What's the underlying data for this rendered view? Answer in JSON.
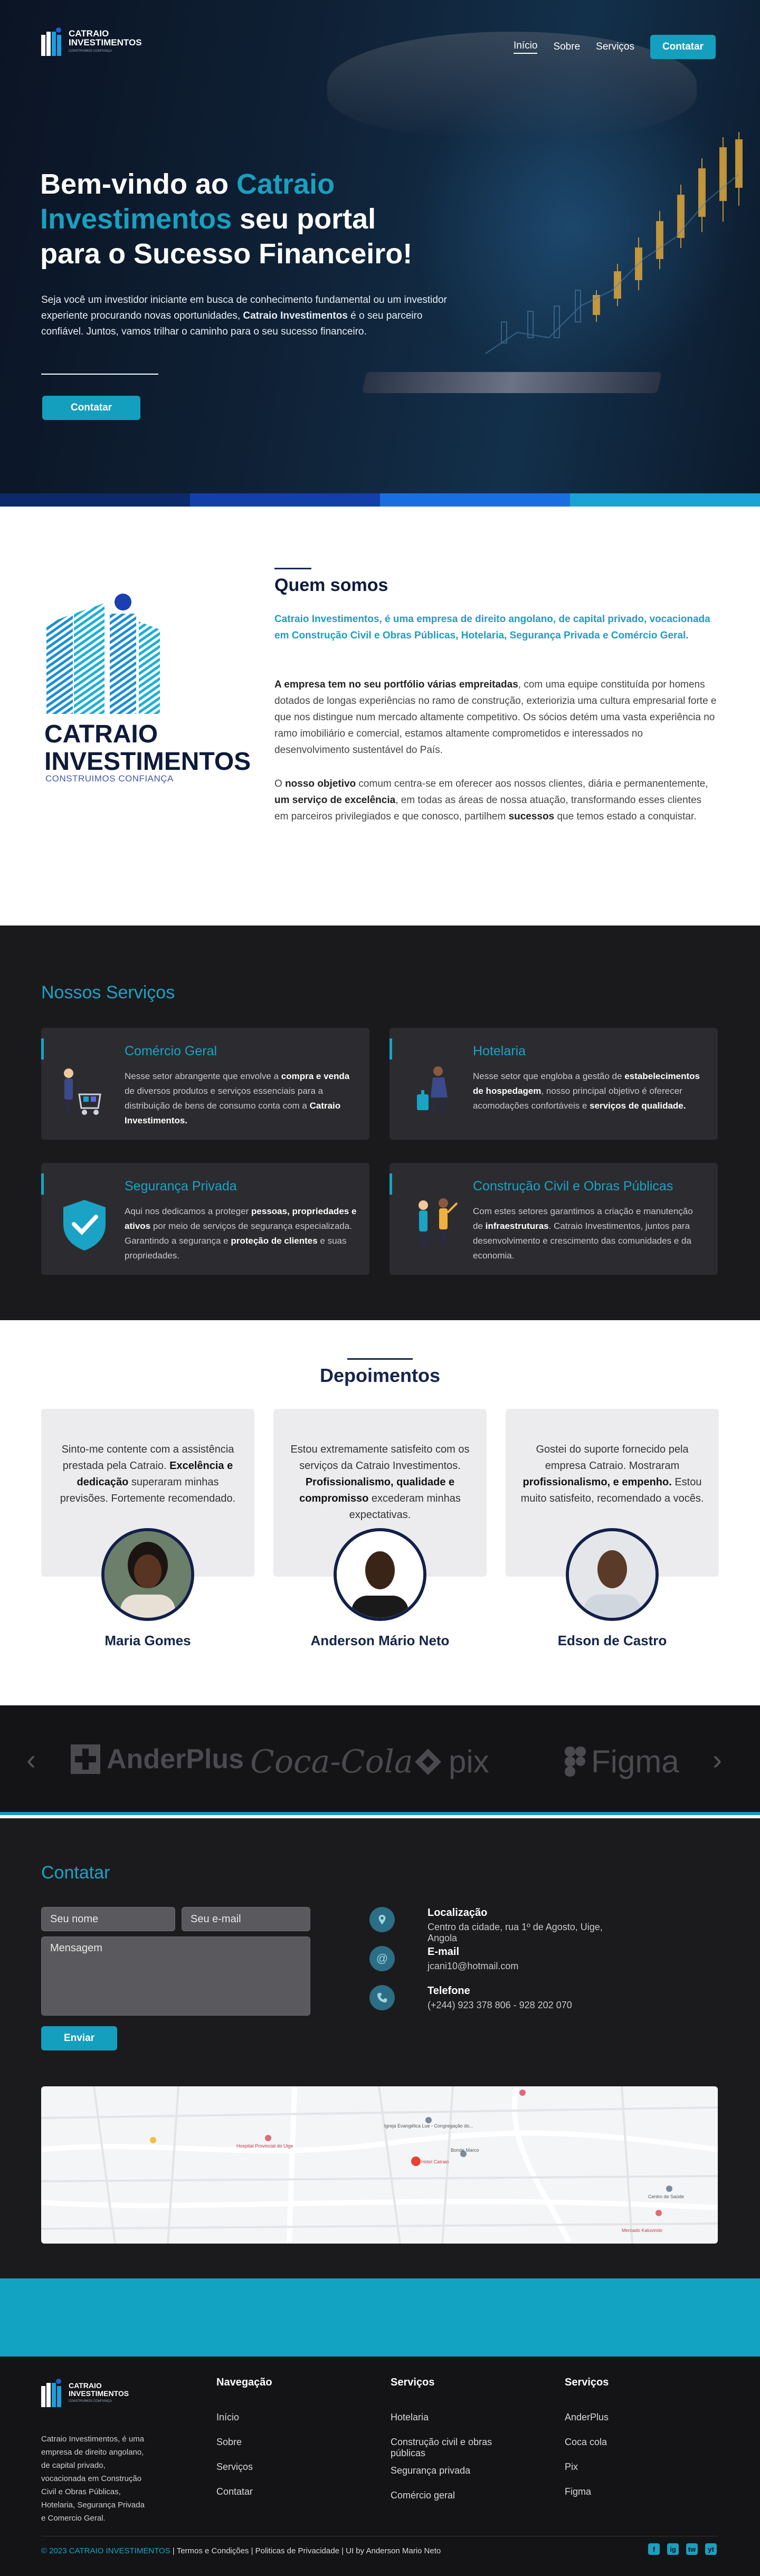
{
  "brand": {
    "name_line1": "CATRAIO",
    "name_line2": "INVESTIMENTOS",
    "tagline": "CONSTRUIMOS CONFIANÇA"
  },
  "nav": {
    "items": [
      "Início",
      "Sobre",
      "Serviços"
    ],
    "contact_label": "Contatar"
  },
  "hero": {
    "title_pre": "Bem-vindo ao ",
    "title_brand": "Catraio Investimentos",
    "title_post": " seu portal para o Sucesso Financeiro!",
    "text_pre": "Seja você um investidor iniciante em busca de conhecimento fundamental ou um investidor experiente procurando novas oportunidades, ",
    "text_bold": "Catraio Investimentos",
    "text_post": " é o seu parceiro confiável. Juntos, vamos trilhar o caminho para o seu sucesso financeiro.",
    "cta_label": "Contatar"
  },
  "about": {
    "title": "Quem somos",
    "lead": "Catraio Investimentos, é uma empresa de direito angolano, de capital privado, vocacionada em Construção Civil e Obras Públicas, Hotelaria, Segurança Privada e Comércio Geral.",
    "p2_bold": "A empresa tem no seu portfólio várias empreitadas",
    "p2_rest": ", com uma equipe constituída por homens dotados de longas experiências no ramo de construção, exteriorizia uma cultura empresarial forte e que nos distingue num mercado altamente competitivo. Os sócios detém uma vasta experiência no ramo imobiliário e comercial, estamos altamente comprometidos e interessados no desenvolvimento sustentável do País.",
    "p3_a": "O ",
    "p3_b": "nosso objetivo",
    "p3_c": " comum centra-se em oferecer aos nossos clientes, diária e permanentemente, ",
    "p3_d": "um serviço de excelência",
    "p3_e": ", em todas as áreas de nossa atuação, transformando esses clientes em parceiros privilegiados e que conosco, partilhem ",
    "p3_f": "sucessos",
    "p3_g": " que temos estado a conquistar."
  },
  "services": {
    "title": "Nossos Serviços",
    "items": [
      {
        "title": "Comércio Geral",
        "t1": "Nesse setor abrangente que envolve a ",
        "b1": "compra e venda",
        "t2": " de diversos produtos e serviços essenciais para a distribuição de bens de consumo conta com a ",
        "b2": "Catraio Investimentos.",
        "t3": ""
      },
      {
        "title": "Hotelaria",
        "t1": "Nesse setor que engloba a gestão de ",
        "b1": "estabelecimentos de hospedagem",
        "t2": ", nosso principal objetivo é oferecer acomodações confortáveis e ",
        "b2": "serviços de qualidade.",
        "t3": ""
      },
      {
        "title": "Segurança Privada",
        "t1": "Aqui nos dedicamos a proteger ",
        "b1": "pessoas, propriedades e ativos",
        "t2": " por meio de serviços de segurança especializada. Garantindo a segurança e ",
        "b2": "proteção de clientes",
        "t3": " e suas propriedades."
      },
      {
        "title": "Construção Civil e Obras Públicas",
        "t1": "Com estes setores garantimos a criação e manutenção de ",
        "b1": "infraestruturas",
        "t2": ". Catraio Investimentos, juntos para desenvolvimento e crescimento das comunidades e da economia.",
        "b2": "",
        "t3": ""
      }
    ]
  },
  "testimonials": {
    "title": "Depoimentos",
    "items": [
      {
        "t1": "Sinto-me contente com a assistência prestada pela Catraio. ",
        "b1": "Excelência e dedicação",
        "t2": " superaram minhas previsões. Fortemente recomendado.",
        "name": "Maria Gomes"
      },
      {
        "t1": "Estou extremamente satisfeito com os serviços da Catraio Investimentos. ",
        "b1": "Profissionalismo, qualidade e compromisso",
        "t2": " excederam minhas expectativas.",
        "name": "Anderson Mário Neto"
      },
      {
        "t1": "Gostei do suporte fornecido pela empresa Catraio. Mostraram ",
        "b1": "profissionalismo, e empenho.",
        "t2": " Estou muito satisfeito, recomendado a vocês.",
        "name": "Edson de Castro"
      }
    ]
  },
  "partners": {
    "prev": "‹",
    "next": "›",
    "items": [
      "AnderPlus",
      "Coca-Cola",
      "pix",
      "Figma"
    ]
  },
  "contact": {
    "title": "Contatar",
    "name_placeholder": "Seu nome",
    "email_placeholder": "Seu e-mail",
    "message_placeholder": "Mensagem",
    "send_label": "Enviar",
    "info": [
      {
        "label": "Localização",
        "value": "Centro da cidade, rua 1º de Agosto, Uige, Angola"
      },
      {
        "label": "E-mail",
        "value": "jcani10@hotmail.com"
      },
      {
        "label": "Telefone",
        "value": "(+244) 923 378 806 - 928 202 070"
      }
    ],
    "map_labels": [
      "Hospital Provincial do Uige",
      "Igreja Evangélica Lue - Congregação do...",
      "Hotel Catraio",
      "Bonde Marco",
      "Mercado Kaluvindo",
      "Centro de Saúde"
    ]
  },
  "footer": {
    "description": "Catraio Investimentos, é uma empresa de direito angolano, de capital privado, vocacionada em Construção Civil e Obras Públicas, Hotelaria, Segurança Privada e Comercio Geral.",
    "cols": [
      {
        "title": "Navegação",
        "links": [
          "Início",
          "Sobre",
          "Serviços",
          "Contatar"
        ]
      },
      {
        "title": "Serviços",
        "links": [
          "Hotelaria",
          "Construção civil e obras públicas",
          "Segurança privada",
          "Comércio geral"
        ]
      },
      {
        "title": "Serviços",
        "links": [
          "AnderPlus",
          "Coca cola",
          "Pix",
          "Figma"
        ]
      }
    ],
    "copyright": "© 2023 CATRAIO INVESTIMENTOS",
    "legal": " | Termos e Condições | Politicas de Privacidade | UI  by Anderson Mario Neto",
    "socials": [
      "f",
      "ig",
      "tw",
      "yt"
    ]
  },
  "colors": {
    "accent": "#1aa3c4",
    "navy": "#14244e",
    "dark": "#1a1a1c"
  }
}
